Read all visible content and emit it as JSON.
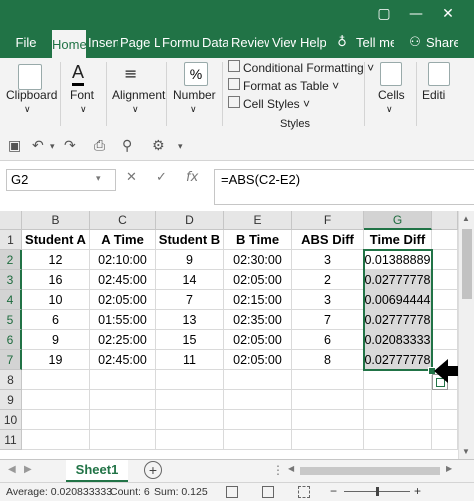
{
  "ribbon_tabs": [
    "File",
    "Home",
    "Insert",
    "Page La",
    "Formula",
    "Data",
    "Review",
    "View",
    "Help",
    "Tell me",
    "Share"
  ],
  "active_tab": "Home",
  "ribbon": {
    "clipboard": "Clipboard",
    "font": "Font",
    "alignment": "Alignment",
    "number": "Number",
    "cond_format": "Conditional Formatting",
    "format_table": "Format as Table",
    "cell_styles": "Cell Styles",
    "styles": "Styles",
    "cells": "Cells",
    "editing": "Editi"
  },
  "name_box": "G2",
  "fx": "fx",
  "formula": "=ABS(C2-E2)",
  "columns": [
    "B",
    "C",
    "D",
    "E",
    "F",
    "G"
  ],
  "rows": [
    "1",
    "2",
    "3",
    "4",
    "5",
    "6",
    "7",
    "8",
    "9",
    "10",
    "11"
  ],
  "header_row": [
    "Student A",
    "A Time",
    "Student B",
    "B Time",
    "ABS Diff",
    "Time Diff"
  ],
  "data_rows": [
    [
      "12",
      "02:10:00",
      "9",
      "02:30:00",
      "3",
      "0.01388889"
    ],
    [
      "16",
      "02:45:00",
      "14",
      "02:05:00",
      "2",
      "0.02777778"
    ],
    [
      "10",
      "02:05:00",
      "7",
      "02:15:00",
      "3",
      "0.00694444"
    ],
    [
      "6",
      "01:55:00",
      "13",
      "02:35:00",
      "7",
      "0.02777778"
    ],
    [
      "9",
      "02:25:00",
      "15",
      "02:05:00",
      "6",
      "0.02083333"
    ],
    [
      "19",
      "02:45:00",
      "11",
      "02:05:00",
      "8",
      "0.02777778"
    ]
  ],
  "sheet_tab": "Sheet1",
  "status": {
    "average": "Average: 0.020833333",
    "count": "Count: 6",
    "sum": "Sum: 0.125"
  },
  "colors": {
    "excel_green": "#217346",
    "selection_fill": "#d9d9d9"
  }
}
